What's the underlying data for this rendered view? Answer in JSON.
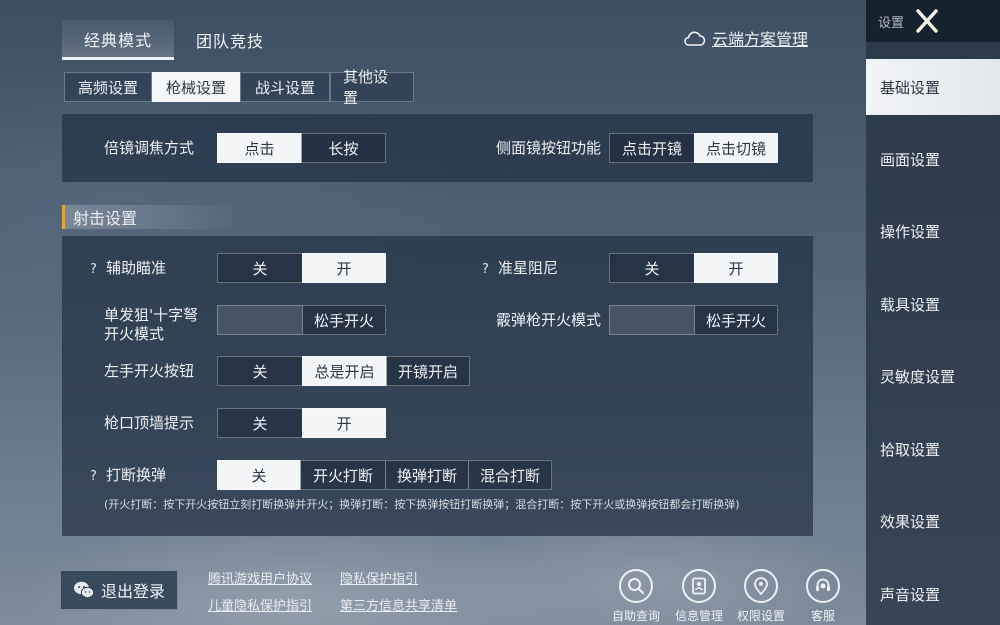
{
  "top_tabs": [
    {
      "label": "经典模式",
      "active": true
    },
    {
      "label": "团队竞技",
      "active": false
    }
  ],
  "cloud": {
    "label": "云端方案管理",
    "icon": "cloud-icon"
  },
  "sub_tabs": [
    {
      "label": "高频设置",
      "active": false
    },
    {
      "label": "枪械设置",
      "active": true
    },
    {
      "label": "战斗设置",
      "active": false
    },
    {
      "label": "其他设置",
      "active": false
    }
  ],
  "scope": {
    "zoom_label": "倍镜调焦方式",
    "zoom_options": [
      "点击",
      "长按"
    ],
    "side_label": "侧面镜按钮功能",
    "side_options": [
      "点击开镜",
      "点击切镜"
    ]
  },
  "section_title": "射击设置",
  "shooting": {
    "aim_assist": {
      "label": "辅助瞄准",
      "options": [
        "关",
        "开"
      ]
    },
    "crosshair_damping": {
      "label": "准星阻尼",
      "options": [
        "关",
        "开"
      ]
    },
    "sniper_fire": {
      "label_1": "单发狙'十字弩",
      "label_2": "开火模式",
      "options": [
        "",
        "松手开火"
      ]
    },
    "shotgun_fire": {
      "label": "霰弹枪开火模式",
      "options": [
        "",
        "松手开火"
      ]
    },
    "left_fire": {
      "label": "左手开火按钮",
      "options": [
        "关",
        "总是开启",
        "开镜开启"
      ]
    },
    "muzzle_wall": {
      "label": "枪口顶墙提示",
      "options": [
        "关",
        "开"
      ]
    },
    "interrupt_reload": {
      "label": "打断换弹",
      "options": [
        "关",
        "开火打断",
        "换弹打断",
        "混合打断"
      ]
    },
    "note": "(开火打断：按下开火按钮立刻打断换弹并开火；换弹打断：按下换弹按钮打断换弹；混合打断：按下开火或换弹按钮都会打断换弹)"
  },
  "help_mark": "?",
  "bottom": {
    "logout_label": "退出登录",
    "links": [
      "腾讯游戏用户协议",
      "隐私保护指引",
      "儿童隐私保护指引",
      "第三方信息共享清单"
    ],
    "icons": [
      {
        "label": "自助查询",
        "icon": "search-icon"
      },
      {
        "label": "信息管理",
        "icon": "id-card-icon"
      },
      {
        "label": "权限设置",
        "icon": "permission-icon"
      },
      {
        "label": "客服",
        "icon": "customer-service-icon"
      }
    ]
  },
  "sidebar": {
    "title": "设置",
    "items": [
      {
        "label": "基础设置",
        "active": true
      },
      {
        "label": "画面设置",
        "active": false
      },
      {
        "label": "操作设置",
        "active": false
      },
      {
        "label": "载具设置",
        "active": false
      },
      {
        "label": "灵敏度设置",
        "active": false
      },
      {
        "label": "拾取设置",
        "active": false
      },
      {
        "label": "效果设置",
        "active": false
      },
      {
        "label": "声音设置",
        "active": false
      }
    ]
  }
}
